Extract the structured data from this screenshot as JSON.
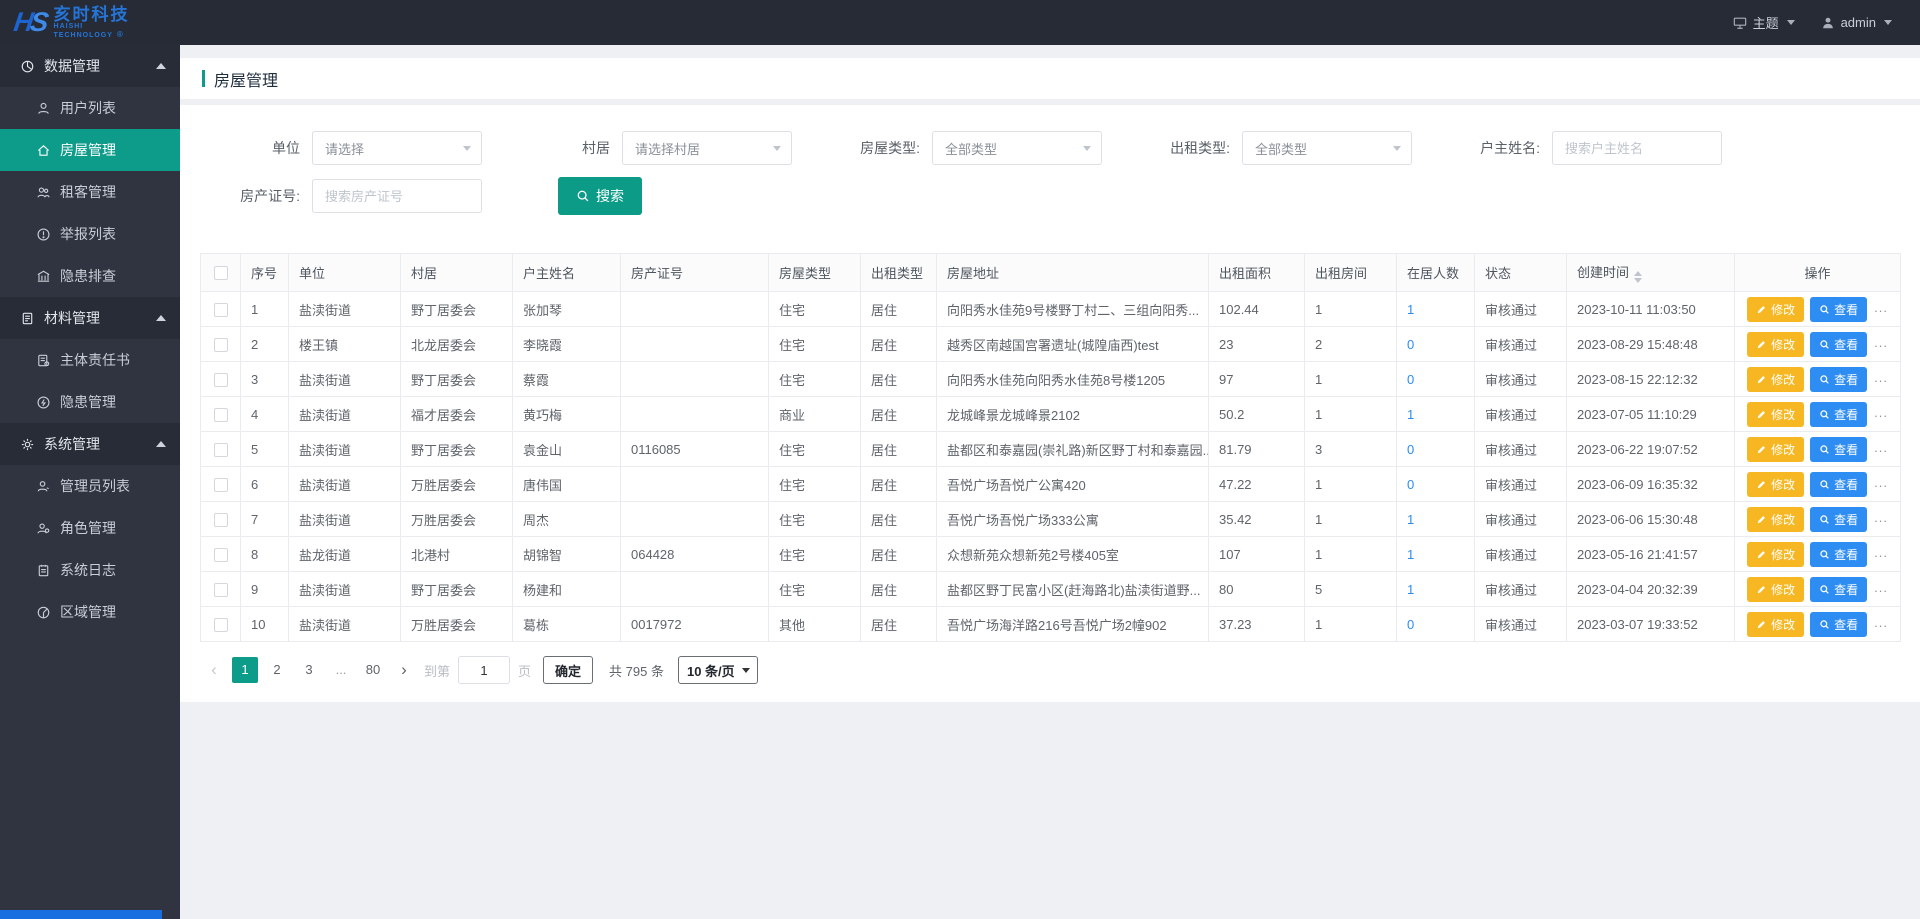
{
  "colors": {
    "accent_teal": "#0d9b8a",
    "header_dark": "#262b36",
    "sidebar_dark": "#2f3440",
    "edit_button_yellow": "#f7b722",
    "view_button_blue": "#2e8df2",
    "link_blue": "#2d8cf0",
    "logo_blue": "#2575d8"
  },
  "brand": {
    "mark": "HS",
    "name_cn": "亥时科技",
    "name_en_line1": "HAISHI",
    "name_en_line2": "TECHNOLOGY",
    "registered": "®"
  },
  "header": {
    "theme_label": "主题",
    "user_name": "admin"
  },
  "sidebar": {
    "groups": [
      {
        "label": "数据管理",
        "icon": "chart-pie-icon",
        "items": [
          {
            "label": "用户列表",
            "icon": "user-icon",
            "active": false
          },
          {
            "label": "房屋管理",
            "icon": "home-icon",
            "active": true
          },
          {
            "label": "租客管理",
            "icon": "tenants-icon",
            "active": false
          },
          {
            "label": "举报列表",
            "icon": "report-icon",
            "active": false
          },
          {
            "label": "隐患排查",
            "icon": "inspect-icon",
            "active": false
          }
        ]
      },
      {
        "label": "材料管理",
        "icon": "material-icon",
        "items": [
          {
            "label": "主体责任书",
            "icon": "responsibility-doc-icon",
            "active": false
          },
          {
            "label": "隐患管理",
            "icon": "hazard-icon",
            "active": false
          }
        ]
      },
      {
        "label": "系统管理",
        "icon": "gear-icon",
        "items": [
          {
            "label": "管理员列表",
            "icon": "admin-list-icon",
            "active": false
          },
          {
            "label": "角色管理",
            "icon": "role-icon",
            "active": false
          },
          {
            "label": "系统日志",
            "icon": "log-icon",
            "active": false
          },
          {
            "label": "区域管理",
            "icon": "region-icon",
            "active": false
          }
        ]
      }
    ]
  },
  "page": {
    "title": "房屋管理"
  },
  "filters": {
    "unit_label": "单位",
    "unit_value": "请选择",
    "village_label": "村居",
    "village_value": "请选择村居",
    "house_type_label": "房屋类型:",
    "house_type_value": "全部类型",
    "rent_type_label": "出租类型:",
    "rent_type_value": "全部类型",
    "owner_label": "户主姓名:",
    "owner_placeholder": "搜索户主姓名",
    "cert_label": "房产证号:",
    "cert_placeholder": "搜索房产证号",
    "search_button": "搜索"
  },
  "table": {
    "columns": [
      "序号",
      "单位",
      "村居",
      "户主姓名",
      "房产证号",
      "房屋类型",
      "出租类型",
      "房屋地址",
      "出租面积",
      "出租房间",
      "在居人数",
      "状态",
      "创建时间",
      "操作"
    ],
    "actions": {
      "edit": "修改",
      "view": "查看",
      "more": "..."
    },
    "rows": [
      {
        "seq": "1",
        "unit": "盐渎街道",
        "village": "野丁居委会",
        "owner": "张加琴",
        "cert": "",
        "house_type": "住宅",
        "rent_type": "居住",
        "address": "向阳秀水佳苑9号楼野丁村二、三组向阳秀...",
        "area": "102.44",
        "rooms": "1",
        "residents": "1",
        "status": "审核通过",
        "created": "2023-10-11 11:03:50"
      },
      {
        "seq": "2",
        "unit": "楼王镇",
        "village": "北龙居委会",
        "owner": "李晓霞",
        "cert": "",
        "house_type": "住宅",
        "rent_type": "居住",
        "address": "越秀区南越国宫署遗址(城隍庙西)test",
        "area": "23",
        "rooms": "2",
        "residents": "0",
        "status": "审核通过",
        "created": "2023-08-29 15:48:48"
      },
      {
        "seq": "3",
        "unit": "盐渎街道",
        "village": "野丁居委会",
        "owner": "蔡霞",
        "cert": "",
        "house_type": "住宅",
        "rent_type": "居住",
        "address": "向阳秀水佳苑向阳秀水佳苑8号楼1205",
        "area": "97",
        "rooms": "1",
        "residents": "0",
        "status": "审核通过",
        "created": "2023-08-15 22:12:32"
      },
      {
        "seq": "4",
        "unit": "盐渎街道",
        "village": "福才居委会",
        "owner": "黄巧梅",
        "cert": "",
        "house_type": "商业",
        "rent_type": "居住",
        "address": "龙城峰景龙城峰景2102",
        "area": "50.2",
        "rooms": "1",
        "residents": "1",
        "status": "审核通过",
        "created": "2023-07-05 11:10:29"
      },
      {
        "seq": "5",
        "unit": "盐渎街道",
        "village": "野丁居委会",
        "owner": "袁金山",
        "cert": "0116085",
        "house_type": "住宅",
        "rent_type": "居住",
        "address": "盐都区和泰嘉园(崇礼路)新区野丁村和泰嘉园...",
        "area": "81.79",
        "rooms": "3",
        "residents": "0",
        "status": "审核通过",
        "created": "2023-06-22 19:07:52"
      },
      {
        "seq": "6",
        "unit": "盐渎街道",
        "village": "万胜居委会",
        "owner": "唐伟国",
        "cert": "",
        "house_type": "住宅",
        "rent_type": "居住",
        "address": "吾悦广场吾悦广公寓420",
        "area": "47.22",
        "rooms": "1",
        "residents": "0",
        "status": "审核通过",
        "created": "2023-06-09 16:35:32"
      },
      {
        "seq": "7",
        "unit": "盐渎街道",
        "village": "万胜居委会",
        "owner": "周杰",
        "cert": "",
        "house_type": "住宅",
        "rent_type": "居住",
        "address": "吾悦广场吾悦广场333公寓",
        "area": "35.42",
        "rooms": "1",
        "residents": "1",
        "status": "审核通过",
        "created": "2023-06-06 15:30:48"
      },
      {
        "seq": "8",
        "unit": "盐龙街道",
        "village": "北港村",
        "owner": "胡锦智",
        "cert": "064428",
        "house_type": "住宅",
        "rent_type": "居住",
        "address": "众想新苑众想新苑2号楼405室",
        "area": "107",
        "rooms": "1",
        "residents": "1",
        "status": "审核通过",
        "created": "2023-05-16 21:41:57"
      },
      {
        "seq": "9",
        "unit": "盐渎街道",
        "village": "野丁居委会",
        "owner": "杨建和",
        "cert": "",
        "house_type": "住宅",
        "rent_type": "居住",
        "address": "盐都区野丁民富小区(赶海路北)盐渎街道野...",
        "area": "80",
        "rooms": "5",
        "residents": "1",
        "status": "审核通过",
        "created": "2023-04-04 20:32:39"
      },
      {
        "seq": "10",
        "unit": "盐渎街道",
        "village": "万胜居委会",
        "owner": "葛栋",
        "cert": "0017972",
        "house_type": "其他",
        "rent_type": "居住",
        "address": "吾悦广场海洋路216号吾悦广场2幢902",
        "area": "37.23",
        "rooms": "1",
        "residents": "0",
        "status": "审核通过",
        "created": "2023-03-07 19:33:52"
      }
    ]
  },
  "pagination": {
    "prev": "‹",
    "pages": [
      "1",
      "2",
      "3",
      "...",
      "80"
    ],
    "active_page": "1",
    "next": "›",
    "goto_prefix": "到第",
    "goto_value": "1",
    "goto_suffix": "页",
    "confirm": "确定",
    "total": "共 795 条",
    "page_size": "10 条/页"
  }
}
